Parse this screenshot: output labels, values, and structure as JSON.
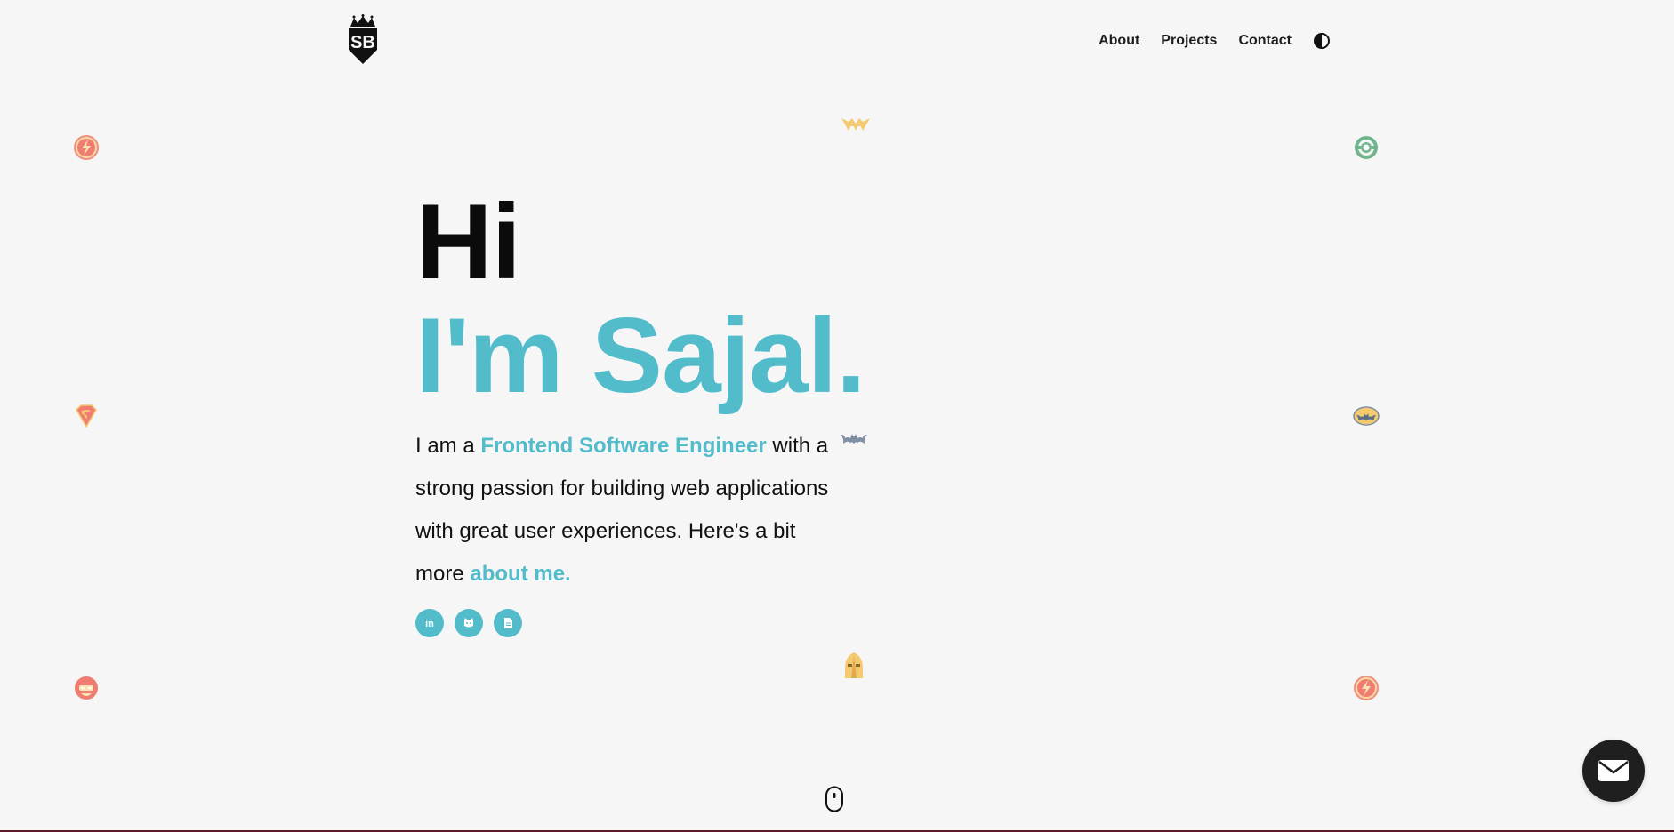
{
  "header": {
    "logo_text": "SB",
    "nav": [
      {
        "label": "About"
      },
      {
        "label": "Projects"
      },
      {
        "label": "Contact"
      }
    ],
    "theme_toggle_icon": "half-circle-contrast-icon"
  },
  "hero": {
    "greeting": "Hi",
    "name_line": "I'm Sajal.",
    "intro_prefix": "I am a ",
    "intro_highlight": "Frontend Software Engineer",
    "intro_middle": " with a strong passion for building web applications with great user experiences. Here's a bit more ",
    "intro_link": "about me."
  },
  "socials": [
    {
      "icon": "linkedin-icon",
      "text": "in"
    },
    {
      "icon": "github-icon"
    },
    {
      "icon": "resume-document-icon"
    }
  ],
  "colors": {
    "accent": "#52bccb",
    "background": "#f6f6f6",
    "text": "#111111",
    "fab": "#1f1f1f"
  },
  "decorations": [
    "flash-logo-icon",
    "wonder-woman-logo-icon",
    "green-lantern-logo-icon",
    "superman-logo-icon",
    "batman-bat-icon",
    "batman-logo-icon",
    "flash-helmet-icon",
    "dr-fate-helmet-icon",
    "flash-logo-icon"
  ],
  "footer": {
    "scroll_icon": "mouse-scroll-icon",
    "fab_icon": "mail-envelope-icon"
  }
}
